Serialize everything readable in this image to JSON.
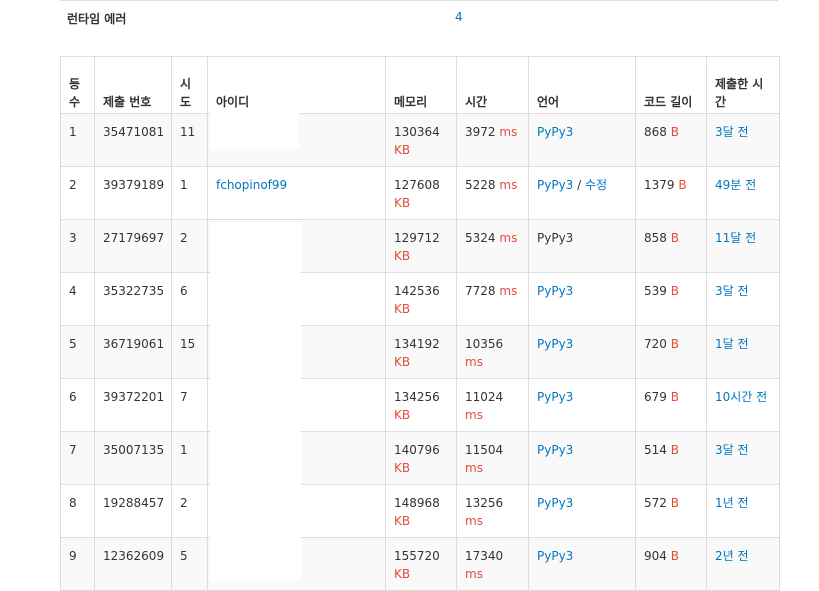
{
  "runtime_error": {
    "label": "런타임 에러",
    "count": "4"
  },
  "columns": {
    "rank": "등수",
    "submission": "제출 번호",
    "attempts": "시도",
    "user": "아이디",
    "memory": "메모리",
    "time": "시간",
    "language": "언어",
    "code_length": "코드 길이",
    "submitted": "제출한 시간"
  },
  "units": {
    "memory": "KB",
    "time": "ms",
    "length": "B"
  },
  "rows": [
    {
      "rank": "1",
      "submission": "35471081",
      "attempts": "11",
      "user": "",
      "memory": "130364",
      "time": "3972",
      "language": "PyPy3",
      "language_link": true,
      "edit": "",
      "code_length": "868",
      "submitted": "3달 전"
    },
    {
      "rank": "2",
      "submission": "39379189",
      "attempts": "1",
      "user": "fchopinof99",
      "memory": "127608",
      "time": "5228",
      "language": "PyPy3",
      "language_link": true,
      "edit": "수정",
      "code_length": "1379",
      "submitted": "49분 전"
    },
    {
      "rank": "3",
      "submission": "27179697",
      "attempts": "2",
      "user": "",
      "memory": "129712",
      "time": "5324",
      "language": "PyPy3",
      "language_link": false,
      "edit": "",
      "code_length": "858",
      "submitted": "11달 전"
    },
    {
      "rank": "4",
      "submission": "35322735",
      "attempts": "6",
      "user": "",
      "memory": "142536",
      "time": "7728",
      "language": "PyPy3",
      "language_link": true,
      "edit": "",
      "code_length": "539",
      "submitted": "3달 전"
    },
    {
      "rank": "5",
      "submission": "36719061",
      "attempts": "15",
      "user": "",
      "memory": "134192",
      "time": "10356",
      "language": "PyPy3",
      "language_link": true,
      "edit": "",
      "code_length": "720",
      "submitted": "1달 전"
    },
    {
      "rank": "6",
      "submission": "39372201",
      "attempts": "7",
      "user": "",
      "memory": "134256",
      "time": "11024",
      "language": "PyPy3",
      "language_link": true,
      "edit": "",
      "code_length": "679",
      "submitted": "10시간 전"
    },
    {
      "rank": "7",
      "submission": "35007135",
      "attempts": "1",
      "user": "",
      "memory": "140796",
      "time": "11504",
      "language": "PyPy3",
      "language_link": true,
      "edit": "",
      "code_length": "514",
      "submitted": "3달 전"
    },
    {
      "rank": "8",
      "submission": "19288457",
      "attempts": "2",
      "user": "",
      "memory": "148968",
      "time": "13256",
      "language": "PyPy3",
      "language_link": true,
      "edit": "",
      "code_length": "572",
      "submitted": "1년 전"
    },
    {
      "rank": "9",
      "submission": "12362609",
      "attempts": "5",
      "user": "",
      "memory": "155720",
      "time": "17340",
      "language": "PyPy3",
      "language_link": true,
      "edit": "",
      "code_length": "904",
      "submitted": "2년 전"
    }
  ]
}
